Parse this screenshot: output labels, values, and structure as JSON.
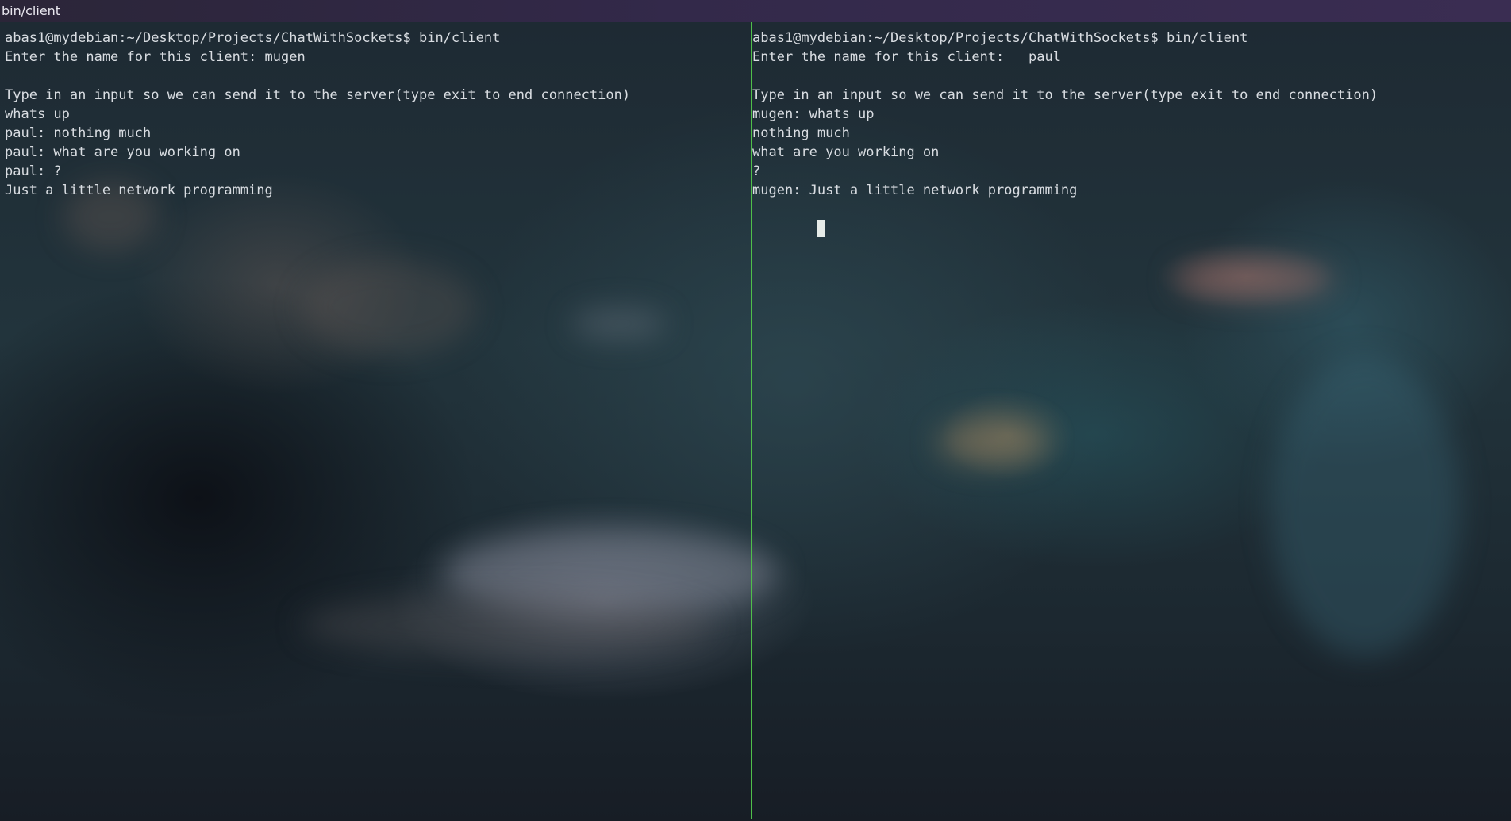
{
  "window": {
    "title": "bin/client"
  },
  "colors": {
    "title_bar": "#33294a",
    "divider": "#4fbf4a",
    "text": "#d9dde2",
    "cursor": "#e6ebe8"
  },
  "left_pane": {
    "lines": [
      "abas1@mydebian:~/Desktop/Projects/ChatWithSockets$ bin/client",
      "Enter the name for this client: mugen",
      "",
      "Type in an input so we can send it to the server(type exit to end connection)",
      "whats up",
      "paul: nothing much",
      "paul: what are you working on",
      "paul: ?",
      "Just a little network programming"
    ]
  },
  "right_pane": {
    "lines": [
      "abas1@mydebian:~/Desktop/Projects/ChatWithSockets$ bin/client",
      "Enter the name for this client:   paul",
      "",
      "Type in an input so we can send it to the server(type exit to end connection)",
      "mugen: whats up",
      "nothing much",
      "what are you working on",
      "?",
      "mugen: Just a little network programming"
    ]
  }
}
